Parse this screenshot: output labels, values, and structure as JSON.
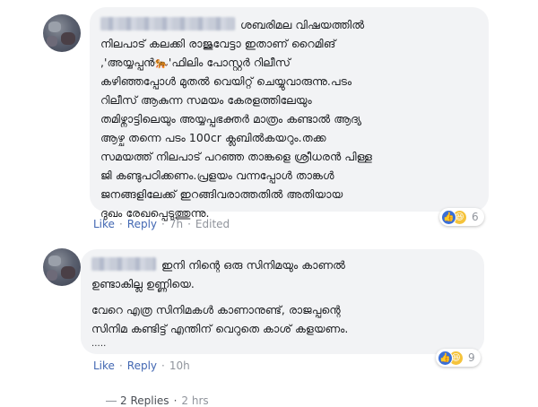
{
  "comments": [
    {
      "lines": [
        "ശബരിമല വിഷയത്തിൽ",
        "നിലപാട് കലക്കി രാജുവേട്ടാ ഇതാണ് റൈമിങ്",
        ",'അയ്യപ്പൻ🐅'ഫിലിം പോസ്റ്റർ റിലീസ്",
        "കഴിഞ്ഞപ്പോൾ മുതൽ വെയിറ്റ് ചെയ്യുവാരുന്നു.പടം",
        "റിലീസ് ആകുന്ന സമയം കേരളത്തിലേയും",
        "തമിഴ്നാട്ടിലെയും അയ്യപ്പഭക്തർ മാത്രം കണ്ടാൽ ആദ്യ",
        "ആഴ്ച തന്നെ പടം 100cr ക്ലബിൽകയറും.തക്ക",
        "സമയത്ത് നിലപാട് പറഞ്ഞ താങ്കളെ ശ്രീധരൻ പിള്ള",
        "ജി കണ്ടുപഠിക്കണം.പ്രളയം വന്നപ്പോൾ താങ്കൾ",
        "ജനങ്ങളിലേക്ക് ഇറങ്ങിവരാത്തതിൽ അതിയായ",
        "ദുഖം രേഖപ്പെടുത്തുന്നു."
      ],
      "actions": {
        "like": "Like",
        "reply": "Reply",
        "time": "7h",
        "edited": "Edited"
      },
      "reaction_count": "6"
    },
    {
      "lines": [
        "ഇനി നിന്റെ ഒരു സിനിമയും കാണൽ",
        "ഉണ്ടാകില്ല ഉണ്ണിയെ."
      ],
      "lines2": [
        "വേറെ എത്ര സിനിമകൾ കാണാനുണ്ട്, രാജപ്പന്റെ",
        "സിനിമ കണ്ടിട്ട് എന്തിന് വെറുതെ കാശ് കളയണം."
      ],
      "ellipsis": ".....",
      "actions": {
        "like": "Like",
        "reply": "Reply",
        "time": "10h"
      },
      "reaction_count": "9",
      "replies": {
        "label": "2 Replies",
        "time": "2 hrs"
      }
    }
  ],
  "icons": {
    "like": "like-thumb-icon",
    "haha": "haha-emoji-icon"
  },
  "colors": {
    "bubble": "#f2f3f5",
    "link": "#4267b2",
    "meta": "#90949c",
    "like": "#3b6fd6",
    "haha": "#f5c33b"
  }
}
